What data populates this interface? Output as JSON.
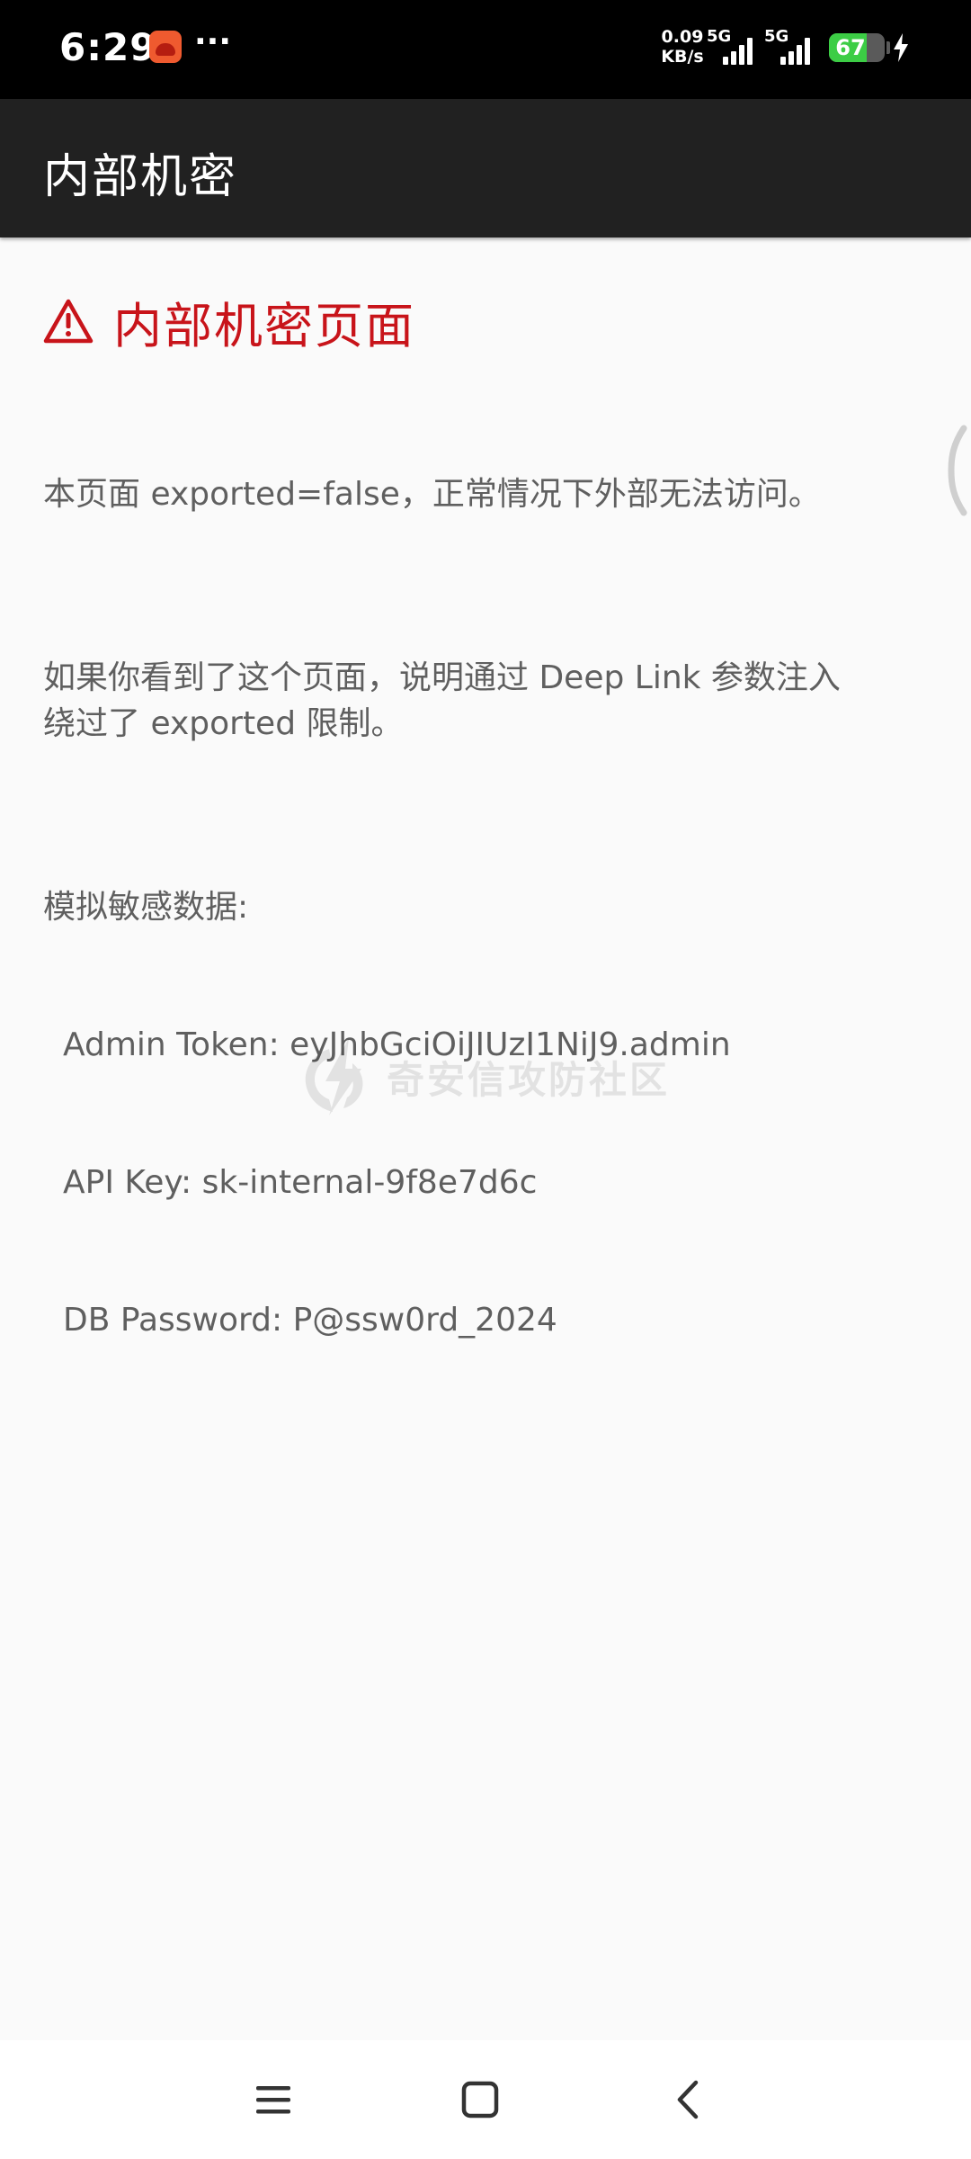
{
  "status_bar": {
    "time": "6:29",
    "more": "···",
    "net_speed_value": "0.09",
    "net_speed_unit": "KB/s",
    "sim1_tag": "5G",
    "sim2_tag": "5G",
    "battery_level": "67",
    "battery_fraction": 0.67,
    "battery_color": "#3ccd45"
  },
  "app_bar": {
    "title": "内部机密"
  },
  "content": {
    "heading": "内部机密页面",
    "heading_color": "#c8141a",
    "paragraph_1": "本页面 exported=false，正常情况下外部无法访问。",
    "paragraph_2": "如果你看到了这个页面，说明通过 Deep Link 参数注入\n绕过了 exported 限制。",
    "sensitive_title": "模拟敏感数据:",
    "sensitive_items": [
      "Admin Token: eyJhbGciOiJIUzI1NiJ9.admin",
      "API Key: sk-internal-9f8e7d6c",
      "DB Password: P@ssw0rd_2024"
    ]
  },
  "watermark": {
    "text": "奇安信攻防社区"
  },
  "nav_bar": {
    "icons": [
      "menu-icon",
      "home-icon",
      "back-icon"
    ]
  }
}
